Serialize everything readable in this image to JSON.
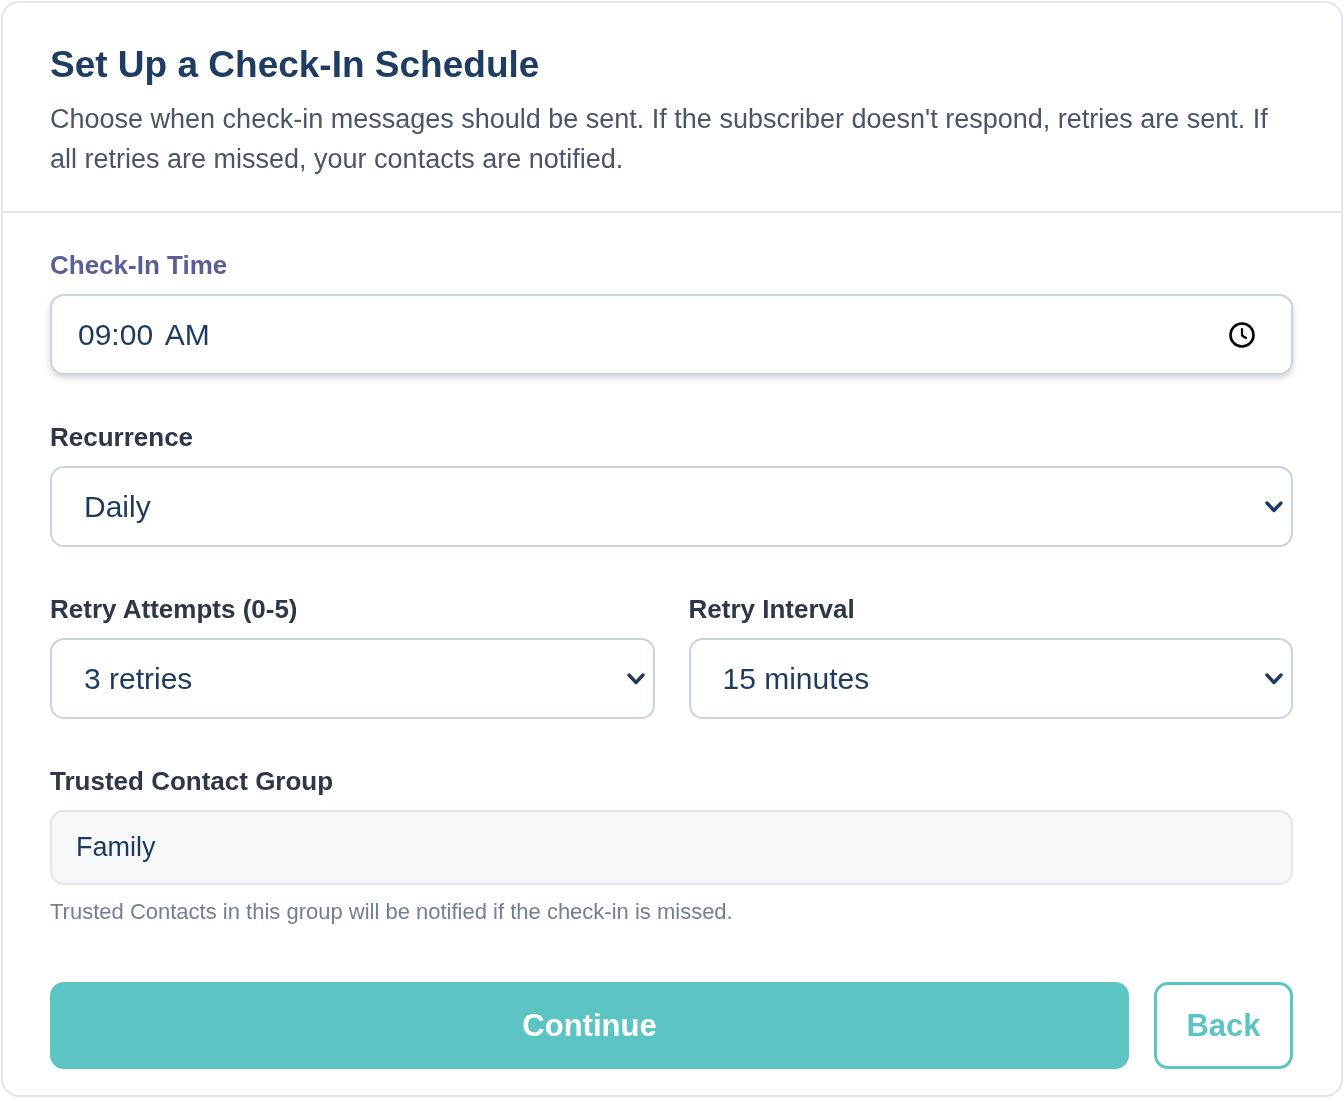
{
  "header": {
    "title": "Set Up a Check-In Schedule",
    "description": "Choose when check-in messages should be sent. If the subscriber doesn't respond, retries are sent. If all retries are missed, your contacts are notified."
  },
  "form": {
    "rows": [
      {
        "fields": [
          {
            "kind": "time",
            "label": "Check-In Time",
            "value": "09:00 AM",
            "focused": true,
            "disabled": false
          }
        ]
      },
      {
        "fields": [
          {
            "kind": "select",
            "label": "Recurrence",
            "value": "Daily",
            "focused": false,
            "disabled": false
          }
        ]
      },
      {
        "fields": [
          {
            "kind": "select",
            "label": "Retry Attempts (0-5)",
            "value": "3 retries",
            "focused": false,
            "disabled": false
          },
          {
            "kind": "select",
            "label": "Retry Interval",
            "value": "15 minutes",
            "focused": false,
            "disabled": false
          }
        ]
      },
      {
        "fields": [
          {
            "kind": "text",
            "label": "Trusted Contact Group",
            "value": "Family",
            "focused": false,
            "disabled": true,
            "hint": "Trusted Contacts in this group will be notified if the check-in is missed."
          }
        ]
      }
    ]
  },
  "buttons": [
    {
      "kind": "primary",
      "label": "Continue"
    },
    {
      "kind": "secondary",
      "label": "Back"
    }
  ]
}
